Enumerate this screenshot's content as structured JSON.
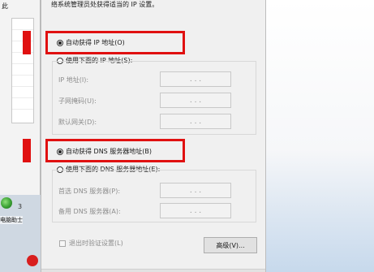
{
  "background": {
    "window_fragment_text": "此",
    "digit": "3",
    "desktop_icon_label": "电脑助士"
  },
  "dialog": {
    "intro_text": "络系统管理员处获得适当的 IP 设置。",
    "ip_section": {
      "auto_label": "自动获得 IP 地址(O)",
      "manual_label": "使用下面的 IP 地址(S):",
      "fields": [
        {
          "label": "IP 地址(I):",
          "value": ".   .   ."
        },
        {
          "label": "子网掩码(U):",
          "value": ".   .   ."
        },
        {
          "label": "默认网关(D):",
          "value": ".   .   ."
        }
      ]
    },
    "dns_section": {
      "auto_label": "自动获得 DNS 服务器地址(B)",
      "manual_label": "使用下面的 DNS 服务器地址(E):",
      "fields": [
        {
          "label": "首选 DNS 服务器(P):",
          "value": ".   .   ."
        },
        {
          "label": "备用 DNS 服务器(A):",
          "value": ".   .   ."
        }
      ]
    },
    "validate_on_exit_label": "退出时验证设置(L)",
    "advanced_button": "高级(V)..."
  },
  "colors": {
    "highlight": "#e01010",
    "dialog_bg": "#f0f0f0",
    "disabled_text": "#8d8d8d"
  }
}
